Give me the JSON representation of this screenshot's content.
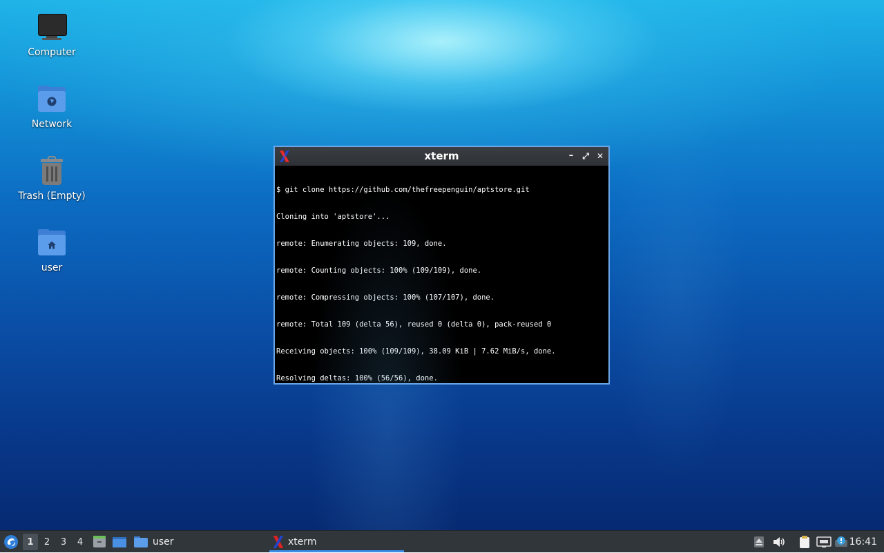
{
  "desktop": {
    "icons": [
      {
        "label": "Computer",
        "icon": "computer-icon"
      },
      {
        "label": "Network",
        "icon": "network-folder-icon"
      },
      {
        "label": "Trash (Empty)",
        "icon": "trash-icon"
      },
      {
        "label": "user",
        "icon": "home-folder-icon"
      }
    ]
  },
  "xterm": {
    "title": "xterm",
    "lines": [
      "$ git clone https://github.com/thefreepenguin/aptstore.git",
      "Cloning into 'aptstore'...",
      "remote: Enumerating objects: 109, done.",
      "remote: Counting objects: 100% (109/109), done.",
      "remote: Compressing objects: 100% (107/107), done.",
      "remote: Total 109 (delta 56), reused 0 (delta 0), pack-reused 0",
      "Receiving objects: 100% (109/109), 38.09 KiB | 7.62 MiB/s, done.",
      "Resolving deltas: 100% (56/56), done."
    ],
    "prompt": "$",
    "buttons": {
      "minimize": "–",
      "maximize": "⤢",
      "close": "✕"
    }
  },
  "taskbar": {
    "workspaces": [
      "1",
      "2",
      "3",
      "4"
    ],
    "active_workspace": "1",
    "tasks": [
      {
        "label": "user",
        "icon": "folder-icon"
      },
      {
        "label": "xterm",
        "icon": "xterm-icon",
        "active": true
      }
    ],
    "clock": "16:41"
  },
  "colors": {
    "accent": "#3d8ee8",
    "taskbar_bg": "#31363b",
    "window_border": "#6aa6e8"
  }
}
